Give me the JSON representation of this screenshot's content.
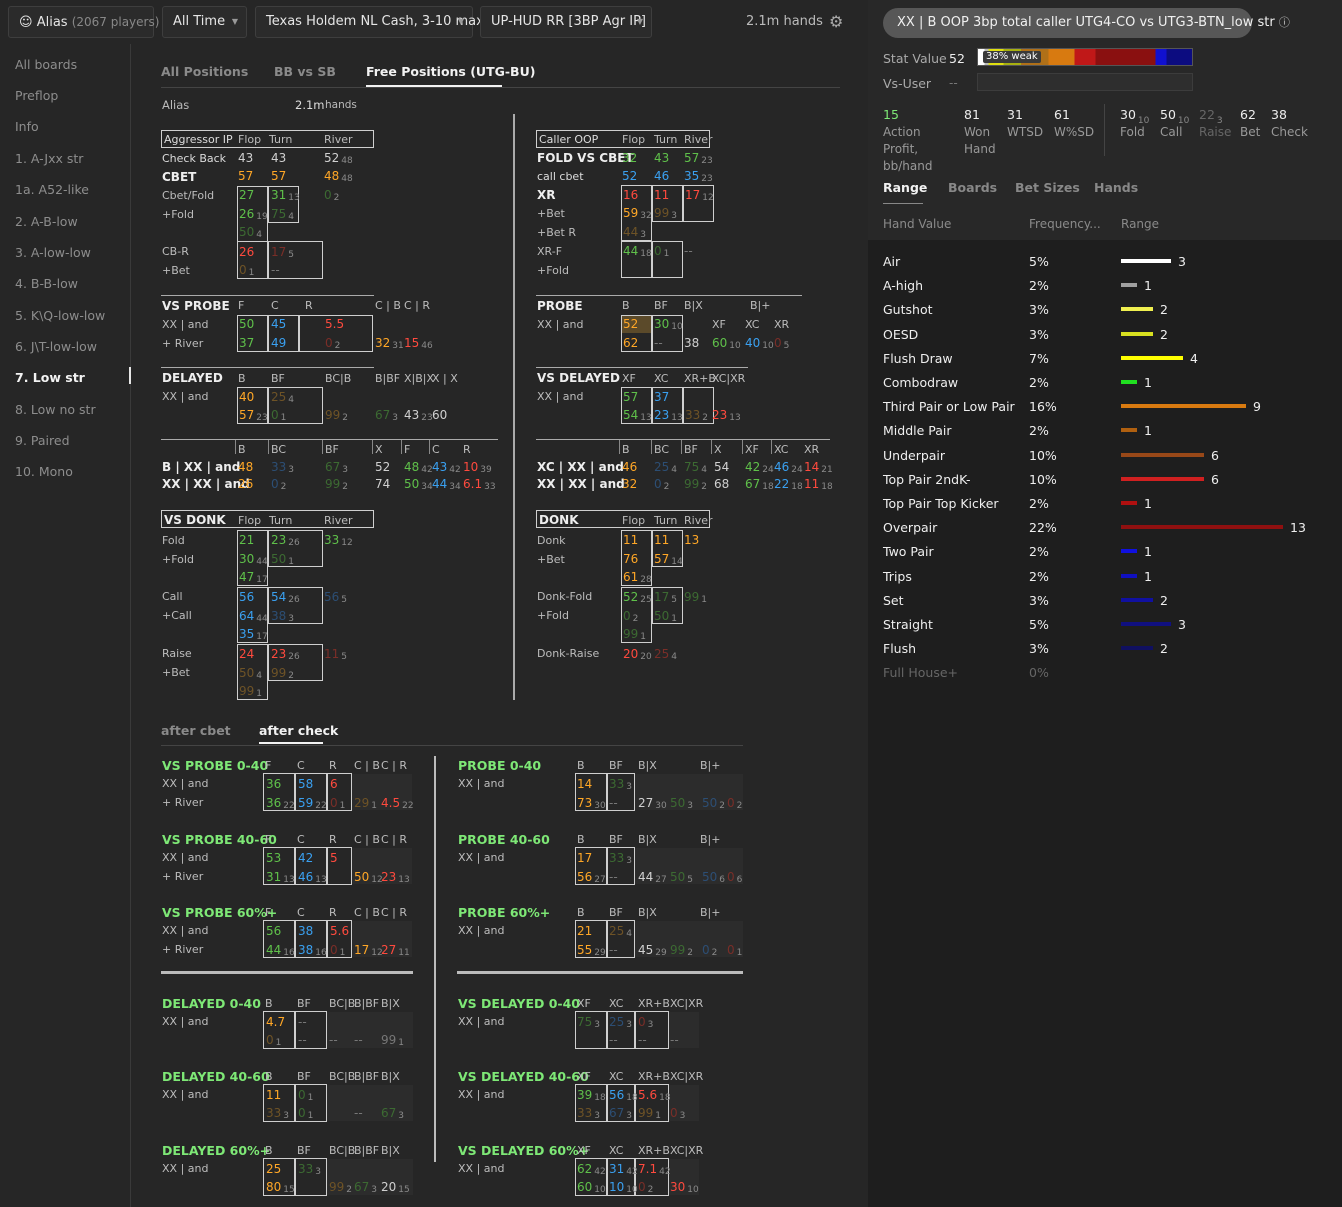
{
  "topbar": {
    "alias": "Alias",
    "players": "(2067 players)",
    "time": "All Time",
    "game": "Texas Holdem NL Cash, 3-10 max",
    "hud": "UP-HUD RR [3BP Agr IP]",
    "hands": "2.1m hands"
  },
  "sidebar": [
    "All boards",
    "Preflop",
    "Info",
    "1. A-Jxx str",
    "1a. A52-like",
    "2. A-B-low",
    "3. A-low-low",
    "4. B-B-low",
    "5. K\\Q-low-low",
    "6. J\\T-low-low",
    "7. Low str",
    "8. Low no str",
    "9. Paired",
    "10. Mono"
  ],
  "tabs": [
    "All Positions",
    "BB vs SB",
    "Free Positions (UTG-BU)"
  ],
  "alias_row": {
    "label": "Alias",
    "hands": "2.1m",
    "hands_unit": "hands"
  },
  "subtabs": [
    "after cbet",
    "after check"
  ],
  "panel": {
    "title": "XX | B OOP 3bp total caller UTG4-CO vs UTG3-BTN_low str",
    "stat_value_label": "Stat Value",
    "stat_value": "52",
    "weak": "38% weak",
    "vs_user_label": "Vs-User",
    "vs_user": "--",
    "stats": [
      {
        "v": "15",
        "l": "Action Profit, bb/hand"
      },
      {
        "v": "81",
        "l": "Won Hand"
      },
      {
        "v": "31",
        "l": "WTSD"
      },
      {
        "v": "61",
        "l": "W%SD"
      },
      {
        "v": "30",
        "s": "10",
        "l": "Fold"
      },
      {
        "v": "50",
        "s": "10",
        "l": "Call"
      },
      {
        "v": "22",
        "s": "3",
        "l": "Raise"
      },
      {
        "v": "62",
        "l": "Bet"
      },
      {
        "v": "38",
        "l": "Check"
      }
    ],
    "tabs": [
      "Range",
      "Boards",
      "Bet Sizes",
      "Hands"
    ],
    "cols": [
      "Hand Value",
      "Frequency...",
      "Range"
    ],
    "rows": [
      {
        "name": "Air",
        "freq": "5%",
        "n": "3",
        "w": 0.3077,
        "color": "#ffffff"
      },
      {
        "name": "A-high",
        "freq": "2%",
        "n": "1",
        "w": 0.1,
        "color": "#a0a0a0"
      },
      {
        "name": "Gutshot",
        "freq": "3%",
        "n": "2",
        "w": 0.2,
        "color": "#f0f050"
      },
      {
        "name": "OESD",
        "freq": "3%",
        "n": "2",
        "w": 0.2,
        "color": "#d8e020"
      },
      {
        "name": "Flush Draw",
        "freq": "7%",
        "n": "4",
        "w": 0.3846,
        "color": "#ffff00"
      },
      {
        "name": "Combodraw",
        "freq": "2%",
        "n": "1",
        "w": 0.1,
        "color": "#20e020"
      },
      {
        "name": "Third Pair or Low Pair",
        "freq": "16%",
        "n": "9",
        "w": 0.7692,
        "color": "#d87a10"
      },
      {
        "name": "Middle Pair",
        "freq": "2%",
        "n": "1",
        "w": 0.1,
        "color": "#b06010"
      },
      {
        "name": "Underpair",
        "freq": "10%",
        "n": "6",
        "w": 0.5154,
        "color": "#984818"
      },
      {
        "name": "Top Pair 2ndK-",
        "freq": "10%",
        "n": "6",
        "w": 0.5154,
        "color": "#d02020"
      },
      {
        "name": "Top Pair Top Kicker",
        "freq": "2%",
        "n": "1",
        "w": 0.1,
        "color": "#b01010"
      },
      {
        "name": "Overpair",
        "freq": "22%",
        "n": "13",
        "w": 1.0,
        "color": "#901010"
      },
      {
        "name": "Two Pair",
        "freq": "2%",
        "n": "1",
        "w": 0.1,
        "color": "#1010e0"
      },
      {
        "name": "Trips",
        "freq": "2%",
        "n": "1",
        "w": 0.1,
        "color": "#1010c0"
      },
      {
        "name": "Set",
        "freq": "3%",
        "n": "2",
        "w": 0.2,
        "color": "#1010a0"
      },
      {
        "name": "Straight",
        "freq": "5%",
        "n": "3",
        "w": 0.3077,
        "color": "#101080"
      },
      {
        "name": "Flush",
        "freq": "3%",
        "n": "2",
        "w": 0.2,
        "color": "#101060"
      },
      {
        "name": "Full House+",
        "freq": "0%",
        "n": "",
        "w": 0,
        "color": "#000000",
        "dim": true
      }
    ]
  },
  "texts": {
    "agr": [
      "Aggressor IP",
      "Flop",
      "Turn",
      "River",
      "Check Back",
      "CBET",
      "Cbet/Fold",
      "+Fold",
      "CB-R",
      "+Bet"
    ],
    "cal": [
      "Caller OOP",
      "Flop",
      "Turn",
      "River",
      "FOLD VS CBET",
      "call cbet",
      "XR",
      "+Bet",
      "+Bet R",
      "XR-F",
      "+Fold"
    ],
    "vsprobe": [
      "VS PROBE",
      "F",
      "C",
      "R",
      "C | B",
      "C | R",
      "XX | and",
      "+ River"
    ],
    "probe": [
      "PROBE",
      "B",
      "BF",
      "B|X",
      "B|+",
      "XX | and",
      "XF",
      "XC",
      "XR"
    ],
    "delayed": [
      "DELAYED",
      "B",
      "BF",
      "BC|B",
      "B|BF",
      "X|B|X",
      "X | X",
      "XX | and"
    ],
    "vsdelayed": [
      "VS DELAYED",
      "XF",
      "XC",
      "XR+B",
      "XC|XR",
      "XX | and"
    ],
    "bxx": [
      "B",
      "BC",
      "BF",
      "X",
      "F",
      "C",
      "R",
      "B | XX | and",
      "XX | XX | and"
    ],
    "xcxx": [
      "B",
      "BC",
      "BF",
      "X",
      "XF",
      "XC",
      "XR",
      "XC | XX | and",
      "XX | XX | and"
    ],
    "vsdonk": [
      "VS DONK",
      "Flop",
      "Turn",
      "River",
      "Fold",
      "+Fold",
      "Call",
      "+Call",
      "Raise",
      "+Bet"
    ],
    "donk": [
      "DONK",
      "Flop",
      "Turn",
      "River",
      "Donk",
      "+Bet",
      "Donk-Fold",
      "+Fold",
      "Donk-Raise"
    ],
    "bot_titles": [
      "VS PROBE 0-40",
      "VS PROBE 40-60",
      "VS PROBE 60%+",
      "PROBE 0-40",
      "PROBE 40-60",
      "PROBE 60%+",
      "DELAYED 0-40",
      "DELAYED 40-60",
      "DELAYED 60%+",
      "VS DELAYED 0-40",
      "VS DELAYED 40-60",
      "VS DELAYED 60%+"
    ],
    "bot_h1": [
      "F",
      "C",
      "R",
      "C | B",
      "C | R"
    ],
    "bot_h2": [
      "B",
      "BF",
      "B|X",
      "B|+",
      "XF",
      "XC",
      "XR"
    ],
    "bot_h3": [
      "B",
      "BF",
      "BC|B",
      "B|BF",
      "B|X"
    ],
    "bot_h4": [
      "XF",
      "XC",
      "XR+B",
      "XC|XR"
    ],
    "xxand": "XX | and",
    "plusriver": "+ River",
    "dashes": "--"
  },
  "nums": {
    "cb": [
      "43",
      "43",
      "52",
      "48",
      "57",
      "57",
      "48",
      "48",
      "27",
      "31",
      "13",
      "0",
      "2",
      "26",
      "19",
      "75",
      "4",
      "50",
      "4",
      "26",
      "17",
      "5",
      "0",
      "1",
      "--"
    ],
    "cl": [
      "32",
      "43",
      "57",
      "23",
      "52",
      "46",
      "35",
      "23",
      "16",
      "11",
      "17",
      "12",
      "59",
      "32",
      "99",
      "3",
      "44",
      "3",
      "44",
      "18",
      "0",
      "1",
      "--"
    ],
    "vp": [
      "50",
      "45",
      "5.5",
      "37",
      "49",
      "0",
      "2",
      "32",
      "31",
      "15",
      "46"
    ],
    "pr": [
      "52",
      "30",
      "10",
      "62",
      "--",
      "38",
      "60",
      "10",
      "40",
      "10",
      "0",
      "5"
    ],
    "dl": [
      "40",
      "25",
      "4",
      "57",
      "23",
      "0",
      "1",
      "99",
      "2",
      "67",
      "3",
      "43",
      "23",
      "60"
    ],
    "vd": [
      "57",
      "37",
      "54",
      "13",
      "23",
      "13",
      "33",
      "2",
      "23",
      "13"
    ],
    "bx": [
      "48",
      "33",
      "3",
      "67",
      "3",
      "52",
      "48",
      "42",
      "43",
      "42",
      "10",
      "39",
      "26",
      "0",
      "2",
      "99",
      "2",
      "74",
      "50",
      "34",
      "44",
      "34",
      "6.1",
      "33"
    ],
    "xc": [
      "46",
      "25",
      "4",
      "75",
      "4",
      "54",
      "42",
      "24",
      "46",
      "24",
      "14",
      "21",
      "32",
      "0",
      "2",
      "99",
      "2",
      "68",
      "67",
      "18",
      "22",
      "18",
      "11",
      "18"
    ],
    "vk": [
      "21",
      "23",
      "26",
      "33",
      "12",
      "30",
      "44",
      "50",
      "1",
      "47",
      "17",
      "56",
      "54",
      "26",
      "56",
      "5",
      "64",
      "44",
      "38",
      "3",
      "35",
      "17",
      "24",
      "23",
      "26",
      "11",
      "5",
      "50",
      "4",
      "99",
      "2",
      "99",
      "1"
    ],
    "dk": [
      "11",
      "11",
      "13",
      "76",
      "57",
      "14",
      "61",
      "28",
      "52",
      "25",
      "17",
      "5",
      "99",
      "1",
      "0",
      "2",
      "50",
      "1",
      "99",
      "1",
      "20",
      "20",
      "25",
      "4"
    ],
    "b1": [
      "36",
      "58",
      "6",
      "36",
      "22",
      "59",
      "22",
      "0",
      "1",
      "29",
      "1",
      "4.5",
      "22"
    ],
    "b2": [
      "53",
      "42",
      "5",
      "31",
      "13",
      "46",
      "13",
      "50",
      "12",
      "23",
      "13"
    ],
    "b3": [
      "56",
      "38",
      "5.6",
      "44",
      "16",
      "38",
      "16",
      "0",
      "1",
      "17",
      "12",
      "27",
      "11"
    ],
    "p1": [
      "14",
      "33",
      "3",
      "73",
      "30",
      "--",
      "27",
      "30",
      "50",
      "3",
      "50",
      "2",
      "0",
      "2"
    ],
    "p2": [
      "17",
      "33",
      "3",
      "56",
      "27",
      "--",
      "44",
      "27",
      "50",
      "5",
      "50",
      "6",
      "0",
      "6"
    ],
    "p3": [
      "21",
      "25",
      "4",
      "55",
      "29",
      "--",
      "45",
      "29",
      "99",
      "2",
      "0",
      "2",
      "0",
      "1"
    ],
    "d1": [
      "4.7",
      "--",
      "0",
      "1",
      "--",
      "--",
      "--",
      "99",
      "1"
    ],
    "d2": [
      "11",
      "0",
      "1",
      "33",
      "3",
      "0",
      "1",
      "--",
      "67",
      "3"
    ],
    "d3": [
      "25",
      "33",
      "3",
      "80",
      "15",
      "99",
      "2",
      "67",
      "3",
      "20",
      "15"
    ],
    "v1": [
      "75",
      "3",
      "25",
      "3",
      "0",
      "3",
      "--",
      "--",
      "--"
    ],
    "v2": [
      "39",
      "18",
      "56",
      "18",
      "5.6",
      "18",
      "33",
      "3",
      "67",
      "3",
      "99",
      "1",
      "0",
      "3"
    ],
    "v3": [
      "62",
      "42",
      "31",
      "42",
      "7.1",
      "42",
      "60",
      "10",
      "10",
      "10",
      "0",
      "2",
      "30",
      "10"
    ]
  }
}
